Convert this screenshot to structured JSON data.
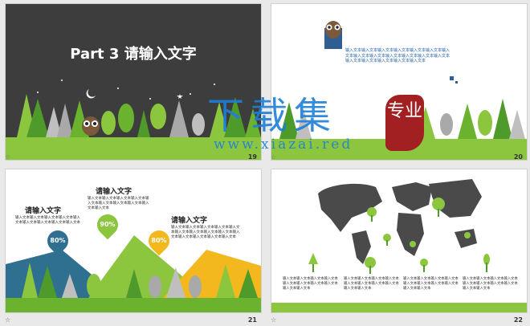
{
  "slides": [
    {
      "number": "19",
      "title": "Part 3 请输入文字"
    },
    {
      "number": "20",
      "text": "输入文本输入文本输入文本输入文本输入文本输入文本输入文本输入文本输入文本输入文本输入文本输入文本输入文本输入文本输入文本输入文本输入文本输入文本"
    },
    {
      "number": "21",
      "blocks": [
        {
          "heading": "请输入文字",
          "text": "输入文本输入文本输入文本输入文本输入文本输入文本输入文本输入文本输入文本",
          "badge": "80%",
          "color": "#2f6f8f"
        },
        {
          "heading": "请输入文字",
          "text": "输入文本输入文本输入文本输入文本输入文本输入文本输入文本输入文本输入文本输入文本",
          "badge": "90%",
          "color": "#8cc63f"
        },
        {
          "heading": "请输入文字",
          "text": "输入文本输入文本输入文本输入文本输入文本输入文本输入文本输入文本输入文本输入文本输入文本输入文本输入文本输入文本",
          "badge": "80%",
          "color": "#f2b81d"
        }
      ]
    },
    {
      "number": "22",
      "captions": [
        "输入文本输入文本输入文本输入文本输入文本输入文本输入文本输入文本输入文本输入文本",
        "输入文本输入文本输入文本输入文本输入文本输入文本输入文本输入文本输入文本输入文本",
        "输入文本输入文本输入文本输入文本输入文本输入文本输入文本输入文本输入文本输入文本",
        "输入文本输入文本输入文本输入文本输入文本输入文本输入文本输入文本输入文本输入文本"
      ]
    }
  ],
  "watermark": {
    "main": "下载集",
    "url": "www.xiazai.red",
    "seal": "专业"
  },
  "icons": {
    "footer": "star-icon",
    "mascot": "owl-icon",
    "moon": "moon-icon"
  },
  "colors": {
    "dark_bg": "#3d3d3d",
    "tree_green": "#8cc63f",
    "tree_dark": "#4e9a2a",
    "mountain_gray": "#a9a9a9",
    "teal": "#2f6f8f",
    "yellow": "#f2b81d",
    "watermark_blue": "#1f7fd6",
    "seal_red": "#a21f22"
  }
}
